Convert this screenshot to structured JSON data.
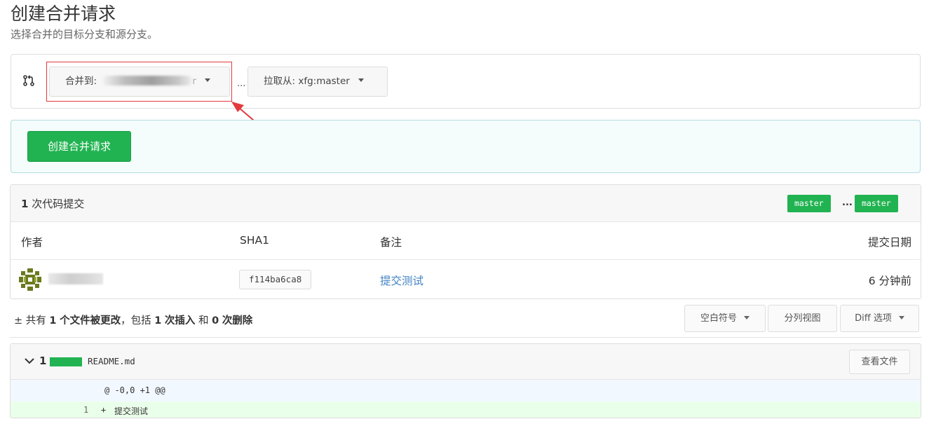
{
  "page": {
    "title": "创建合并请求",
    "subtitle": "选择合并的目标分支和源分支。"
  },
  "branch_select": {
    "target_label": "合并到:",
    "target_value_suffix": "r",
    "separator": "...",
    "source_label": "拉取从: xfg:master"
  },
  "create_button": {
    "label": "创建合并请求"
  },
  "commits": {
    "count": "1",
    "count_label": "次代码提交",
    "compare_left": "master",
    "compare_dots": "...",
    "compare_right": "master",
    "columns": {
      "author": "作者",
      "sha": "SHA1",
      "message": "备注",
      "date": "提交日期"
    },
    "rows": [
      {
        "sha": "f114ba6ca8",
        "message": "提交测试",
        "date": "6 分钟前"
      }
    ]
  },
  "stats": {
    "prefix": "± 共有",
    "files": "1",
    "files_label": "个文件被更改",
    "mid": "，包括",
    "insertions": "1",
    "insertions_label": "次插入",
    "and": "和",
    "deletions": "0",
    "deletions_label": "次删除"
  },
  "toolbar": {
    "whitespace": "空白符号",
    "split_view": "分列视图",
    "diff_options": "Diff 选项"
  },
  "file": {
    "changes": "1",
    "name": "README.md",
    "view_button": "查看文件",
    "hunk_header": "@ -0,0 +1 @@",
    "lines": [
      {
        "num": "1",
        "sign": "+",
        "text": "提交测试"
      }
    ]
  },
  "colors": {
    "accent_green": "#21b351",
    "link_blue": "#4183c4",
    "highlight_red": "#e4393c"
  }
}
